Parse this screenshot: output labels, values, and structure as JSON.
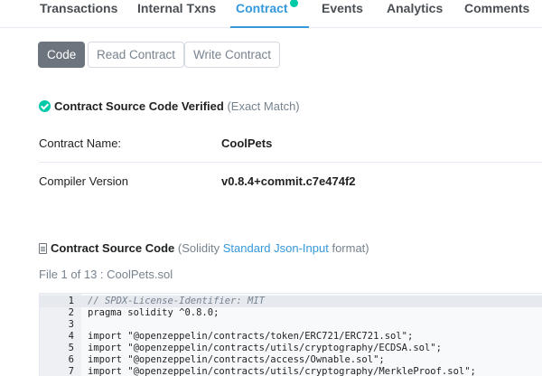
{
  "tabs": [
    {
      "label": "Transactions",
      "active": false
    },
    {
      "label": "Internal Txns",
      "active": false
    },
    {
      "label": "Contract",
      "active": true
    },
    {
      "label": "Events",
      "active": false
    },
    {
      "label": "Analytics",
      "active": false
    },
    {
      "label": "Comments",
      "active": false
    }
  ],
  "buttons": {
    "code": "Code",
    "read": "Read Contract",
    "write": "Write Contract"
  },
  "verification": {
    "title": "Contract Source Code Verified",
    "match": "(Exact Match)"
  },
  "contract_info": {
    "name_label": "Contract Name:",
    "name_value": "CoolPets",
    "compiler_label": "Compiler Version",
    "compiler_value": "v0.8.4+commit.c7e474f2"
  },
  "source": {
    "title": "Contract Source Code",
    "prefix": "(Solidity",
    "link": "Standard Json-Input",
    "suffix": "format)",
    "file_indicator": "File 1 of 13 : CoolPets.sol"
  },
  "code_lines": [
    {
      "n": "1",
      "text": "// SPDX-License-Identifier: MIT",
      "comment": true
    },
    {
      "n": "2",
      "text": "pragma solidity ^0.8.0;",
      "comment": false
    },
    {
      "n": "3",
      "text": "",
      "comment": false
    },
    {
      "n": "4",
      "text": "import \"@openzeppelin/contracts/token/ERC721/ERC721.sol\";",
      "comment": false
    },
    {
      "n": "5",
      "text": "import \"@openzeppelin/contracts/utils/cryptography/ECDSA.sol\";",
      "comment": false
    },
    {
      "n": "6",
      "text": "import \"@openzeppelin/contracts/access/Ownable.sol\";",
      "comment": false
    },
    {
      "n": "7",
      "text": "import \"@openzeppelin/contracts/utils/cryptography/MerkleProof.sol\";",
      "comment": false
    }
  ],
  "colors": {
    "accent": "#3498db",
    "verified": "#00c9a7",
    "active_button": "#6c757d"
  }
}
